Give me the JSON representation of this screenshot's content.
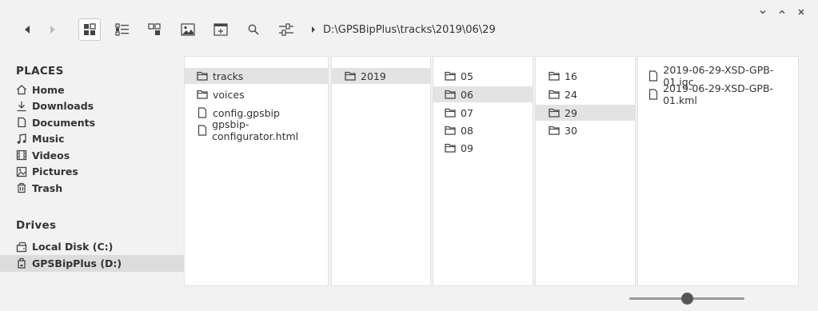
{
  "window": {
    "controls": [
      "minimize",
      "maximize",
      "close"
    ]
  },
  "toolbar": {
    "buttons": [
      "back",
      "forward",
      "icon-view",
      "detail-view",
      "tree-view",
      "image-view",
      "new-window",
      "search",
      "settings"
    ],
    "path": "D:\\GPSBipPlus\\tracks\\2019\\06\\29"
  },
  "sidebar": {
    "places_header": "PLACES",
    "places": [
      {
        "label": "Home",
        "icon": "home-icon"
      },
      {
        "label": "Downloads",
        "icon": "downloads-icon"
      },
      {
        "label": "Documents",
        "icon": "documents-icon"
      },
      {
        "label": "Music",
        "icon": "music-icon"
      },
      {
        "label": "Videos",
        "icon": "videos-icon"
      },
      {
        "label": "Pictures",
        "icon": "pictures-icon"
      },
      {
        "label": "Trash",
        "icon": "trash-icon"
      }
    ],
    "drives_header": "Drives",
    "drives": [
      {
        "label": "Local Disk (C:)",
        "icon": "disk-icon"
      },
      {
        "label": "GPSBipPlus (D:)",
        "icon": "usb-drive-icon",
        "selected": true
      }
    ]
  },
  "columns": [
    {
      "items": [
        {
          "label": "tracks",
          "type": "folder",
          "selected": true
        },
        {
          "label": "voices",
          "type": "folder"
        },
        {
          "label": "config.gpsbip",
          "type": "file"
        },
        {
          "label": "gpsbip-configurator.html",
          "type": "file"
        }
      ]
    },
    {
      "items": [
        {
          "label": "2019",
          "type": "folder",
          "selected": true
        }
      ]
    },
    {
      "items": [
        {
          "label": "05",
          "type": "folder"
        },
        {
          "label": "06",
          "type": "folder",
          "selected": true
        },
        {
          "label": "07",
          "type": "folder"
        },
        {
          "label": "08",
          "type": "folder"
        },
        {
          "label": "09",
          "type": "folder"
        }
      ]
    },
    {
      "items": [
        {
          "label": "16",
          "type": "folder"
        },
        {
          "label": "24",
          "type": "folder"
        },
        {
          "label": "29",
          "type": "folder",
          "selected": true
        },
        {
          "label": "30",
          "type": "folder"
        }
      ]
    },
    {
      "items": [
        {
          "label": "2019-06-29-XSD-GPB-01.igc",
          "type": "file"
        },
        {
          "label": "2019-06-29-XSD-GPB-01.kml",
          "type": "file"
        }
      ]
    }
  ],
  "zoom": {
    "value": 0.5
  }
}
